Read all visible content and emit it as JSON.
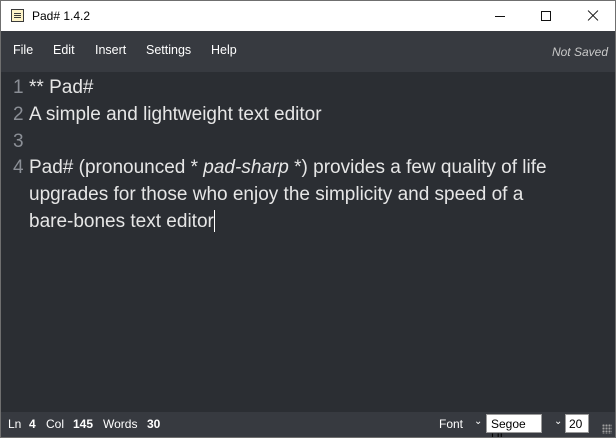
{
  "window": {
    "title": "Pad# 1.4.2"
  },
  "menu": {
    "file": "File",
    "edit": "Edit",
    "insert": "Insert",
    "settings": "Settings",
    "help": "Help",
    "save_status": "Not Saved"
  },
  "editor": {
    "line_numbers": [
      "1",
      "2",
      "3",
      "4"
    ],
    "line1": {
      "marker": "** ",
      "text": "Pad#"
    },
    "line2": "A simple and lightweight text editor",
    "line3": "",
    "line4": {
      "pre": "Pad# (pronounced * ",
      "italic": "pad-sharp",
      "post": " *) provides a few quality of life",
      "wrap1": "upgrades for those who enjoy the simplicity and speed of a",
      "wrap2": "bare-bones text editor"
    }
  },
  "status": {
    "ln_label": "Ln",
    "ln_value": "4",
    "col_label": "Col",
    "col_value": "145",
    "words_label": "Words",
    "words_value": "30",
    "font_label": "Font",
    "font_value": "Segoe UI",
    "size_value": "20"
  },
  "icons": {
    "app": "notepad-icon",
    "min": "minimize-icon",
    "max": "maximize-icon",
    "close": "close-icon"
  }
}
